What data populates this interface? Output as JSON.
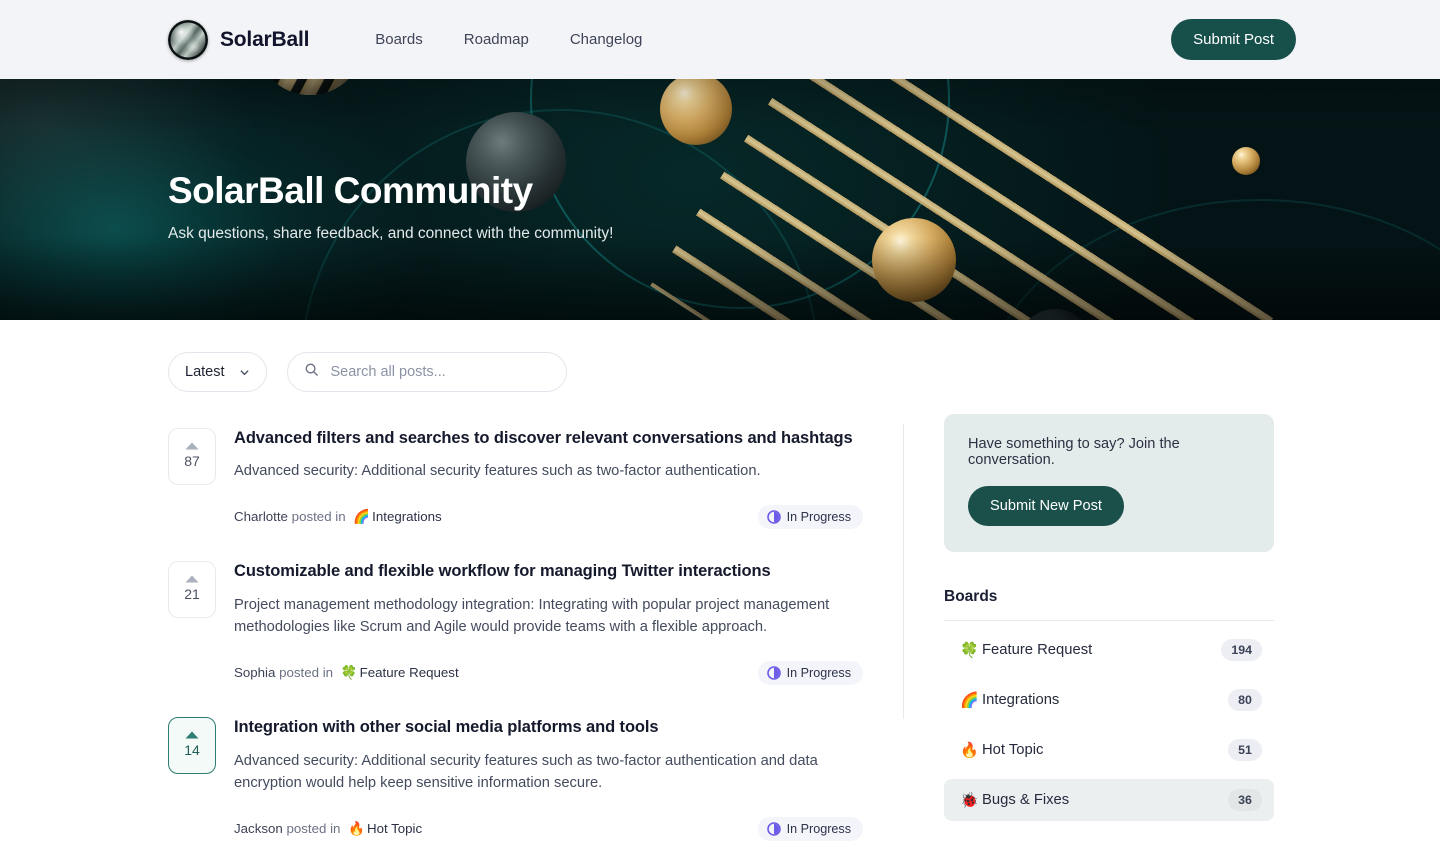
{
  "header": {
    "brand_name": "SolarBall",
    "logo_icon": "solarball-sphere-logo",
    "nav": [
      {
        "label": "Boards"
      },
      {
        "label": "Roadmap"
      },
      {
        "label": "Changelog"
      }
    ],
    "submit_post_label": "Submit Post"
  },
  "hero": {
    "title": "SolarBall Community",
    "subtitle": "Ask questions, share feedback, and connect with the community!"
  },
  "controls": {
    "sort_value": "Latest",
    "sort_chevron_icon": "chevron-down-icon",
    "search_icon": "search-icon",
    "search_value": "",
    "search_placeholder": "Search all posts..."
  },
  "posts": [
    {
      "votes": "87",
      "vote_icon": "upvote-triangle-icon",
      "voted": false,
      "title": "Advanced filters and searches to discover relevant conversations and hashtags",
      "description": "Advanced security: Additional security features such as two-factor authentication.",
      "author": "Charlotte",
      "posted_in": "posted in",
      "board_emoji": "🌈",
      "board": "Integrations",
      "status": "In Progress",
      "status_icon": "in-progress-half-circle-icon"
    },
    {
      "votes": "21",
      "vote_icon": "upvote-triangle-icon",
      "voted": false,
      "title": "Customizable and flexible workflow for managing Twitter interactions",
      "description": "Project management methodology integration: Integrating with popular project management methodologies like Scrum and Agile would provide teams with a flexible approach.",
      "author": "Sophia",
      "posted_in": "posted in",
      "board_emoji": "🍀",
      "board": "Feature Request",
      "status": "In Progress",
      "status_icon": "in-progress-half-circle-icon"
    },
    {
      "votes": "14",
      "vote_icon": "upvote-triangle-icon",
      "voted": true,
      "title": "Integration with other social media platforms and tools",
      "description": "Advanced security: Additional security features such as two-factor authentication and data encryption would help keep sensitive information secure.",
      "author": "Jackson",
      "posted_in": "posted in",
      "board_emoji": "🔥",
      "board": "Hot Topic",
      "status": "In Progress",
      "status_icon": "in-progress-half-circle-icon"
    }
  ],
  "sidebar": {
    "cta_text": "Have something to say? Join the conversation.",
    "cta_button": "Submit New Post",
    "boards_title": "Boards",
    "boards": [
      {
        "emoji": "🍀",
        "label": "Feature Request",
        "count": "194",
        "selected": false
      },
      {
        "emoji": "🌈",
        "label": "Integrations",
        "count": "80",
        "selected": false
      },
      {
        "emoji": "🔥",
        "label": "Hot Topic",
        "count": "51",
        "selected": false
      },
      {
        "emoji": "🐞",
        "label": "Bugs & Fixes",
        "count": "36",
        "selected": true
      }
    ]
  },
  "colors": {
    "brand_dark_teal": "#17504b",
    "hero_background": "#07100f",
    "status_purple": "#6c5ce7",
    "active_vote_teal": "#2e7d72",
    "cta_card_bg": "#e4eceb"
  }
}
